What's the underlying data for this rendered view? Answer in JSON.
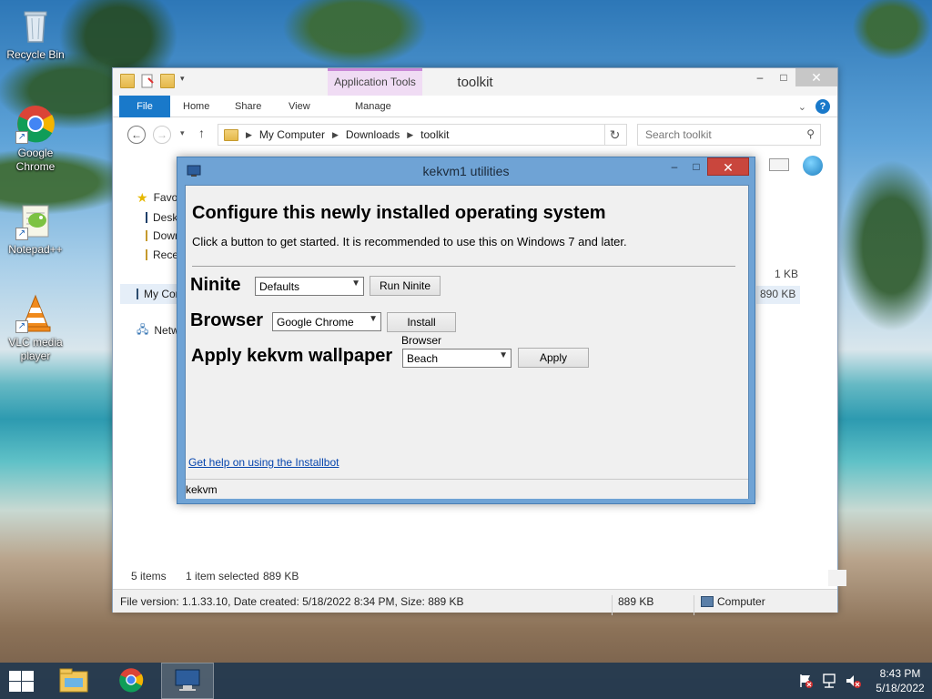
{
  "desktop": {
    "icons": [
      {
        "label": "Recycle Bin"
      },
      {
        "label": "Google Chrome"
      },
      {
        "label": "Notepad++"
      },
      {
        "label": "VLC media player"
      }
    ]
  },
  "explorer": {
    "title": "toolkit",
    "context_tab": "Application Tools",
    "ribbon_tabs": [
      "File",
      "Home",
      "Share",
      "View",
      "Manage"
    ],
    "help": "?",
    "address": {
      "crumbs": [
        "My Computer",
        "Downloads",
        "toolkit"
      ]
    },
    "search": {
      "placeholder": "Search toolkit"
    },
    "nav": {
      "favorites": "Favorites",
      "desktop": "Desktop",
      "downloads": "Downloads",
      "recent": "Recent places",
      "computer": "My Computer",
      "network": "Network"
    },
    "visible_sizes": [
      "1 KB",
      "890 KB"
    ],
    "status": {
      "items": "5 items",
      "selected": "1 item selected",
      "selected_size": "889 KB"
    },
    "details": {
      "info": "File version: 1.1.33.10, Date created: 5/18/2022 8:34 PM, Size: 889 KB",
      "size": "889 KB",
      "location": "Computer"
    }
  },
  "dialog": {
    "title": "kekvm1 utilities",
    "heading": "Configure this newly installed operating system",
    "subheading": "Click a button to get started. It is recommended to use this on Windows 7 and later.",
    "ninite": {
      "label": "Ninite",
      "selected": "Defaults",
      "button": "Run Ninite"
    },
    "browser": {
      "label": "Browser",
      "selected": "Google Chrome",
      "button": "Install Browser"
    },
    "wallpaper": {
      "label": "Apply kekvm wallpaper",
      "selected": "Beach",
      "button": "Apply"
    },
    "help_link": "Get help on using the Installbot",
    "status": "kekvm"
  },
  "taskbar": {
    "time": "8:43 PM",
    "date": "5/18/2022"
  },
  "colors": {
    "accent": "#1979ca",
    "dialog_frame": "#6fa3d5",
    "close_red": "#c9463d",
    "context_tab": "#f0dcf4",
    "link": "#0645ad"
  }
}
